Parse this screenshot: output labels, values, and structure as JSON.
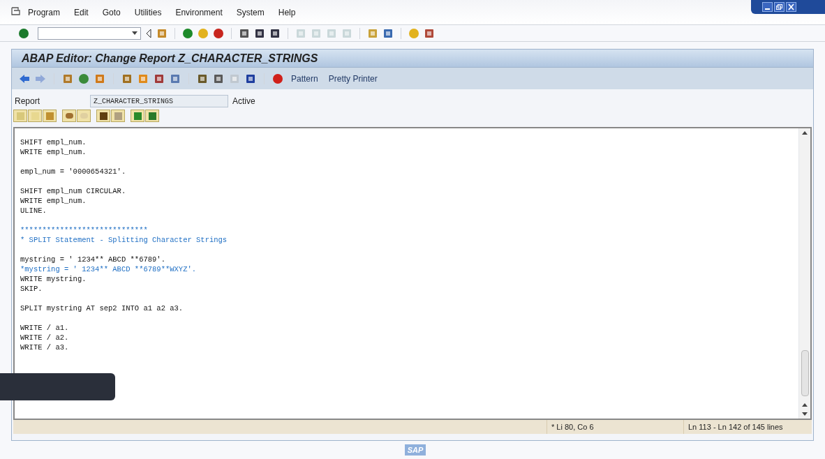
{
  "menu_bar": {
    "items": [
      "Program",
      "Edit",
      "Goto",
      "Utilities",
      "Environment",
      "System",
      "Help"
    ]
  },
  "window": {
    "title": "ABAP Editor: Change Report Z_CHARACTER_STRINGS"
  },
  "app_toolbar": {
    "buttons": [
      "Pattern",
      "Pretty Printer"
    ]
  },
  "report": {
    "label": "Report",
    "value": "Z_CHARACTER_STRINGS",
    "status": "Active"
  },
  "editor": {
    "lines": [
      {
        "kind": "code",
        "text": "SHIFT empl_num."
      },
      {
        "kind": "code",
        "text": "WRITE empl_num."
      },
      {
        "kind": "blank"
      },
      {
        "kind": "code",
        "text": "empl_num = '0000654321'."
      },
      {
        "kind": "blank"
      },
      {
        "kind": "code",
        "text": "SHIFT empl_num CIRCULAR."
      },
      {
        "kind": "code",
        "text": "WRITE empl_num."
      },
      {
        "kind": "code",
        "text": "ULINE."
      },
      {
        "kind": "blank"
      },
      {
        "kind": "comment",
        "text": "*****************************"
      },
      {
        "kind": "comment",
        "text": "* SPLIT Statement - Splitting Character Strings"
      },
      {
        "kind": "blank"
      },
      {
        "kind": "code",
        "text": "mystring = ' 1234** ABCD **6789'."
      },
      {
        "kind": "comment",
        "text": "*mystring = ' 1234** ABCD **6789**WXYZ'."
      },
      {
        "kind": "code",
        "text": "WRITE mystring."
      },
      {
        "kind": "code",
        "text": "SKIP."
      },
      {
        "kind": "blank"
      },
      {
        "kind": "code",
        "text": "SPLIT mystring AT sep2 INTO a1 a2 a3."
      },
      {
        "kind": "blank"
      },
      {
        "kind": "code",
        "text": "WRITE / a1."
      },
      {
        "kind": "code",
        "text": "WRITE / a2."
      },
      {
        "kind": "code",
        "text": "WRITE / a3."
      }
    ]
  },
  "status_bar": {
    "position": "* Li 80, Co 6",
    "range": "Ln 113 - Ln 142 of 145 lines"
  },
  "footer": {
    "logo": "SAP"
  }
}
